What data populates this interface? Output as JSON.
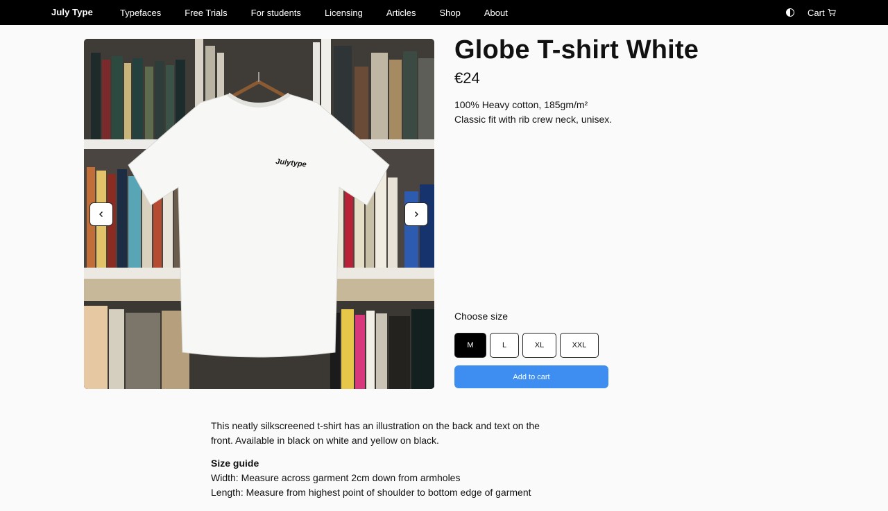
{
  "nav": {
    "brand": "July Type",
    "links": [
      "Typefaces",
      "Free Trials",
      "For students",
      "Licensing",
      "Articles",
      "Shop",
      "About"
    ],
    "theme_icon": "contrast-icon",
    "cart_label": "Cart",
    "cart_icon": "cart-icon"
  },
  "product": {
    "title": "Globe T-shirt White",
    "price": "€24",
    "spec_1": "100% Heavy cotton, 185gm/m²",
    "spec_2": "Classic fit with rib crew neck, unisex.",
    "shirt_print": "Julytype",
    "size_label": "Choose size",
    "sizes": [
      "M",
      "L",
      "XL",
      "XXL"
    ],
    "selected_size": "M",
    "add_to_cart": "Add to cart",
    "accent_color": "#3d8ef0"
  },
  "description": {
    "text": "This neatly silkscreened t-shirt has an illustration on the back and text on the front. Available in black on white and yellow on black.",
    "guide_title": "Size guide",
    "guide_width": "Width: Measure across garment 2cm down from armholes",
    "guide_length": "Length: Measure from highest point of shoulder to bottom edge of garment"
  }
}
